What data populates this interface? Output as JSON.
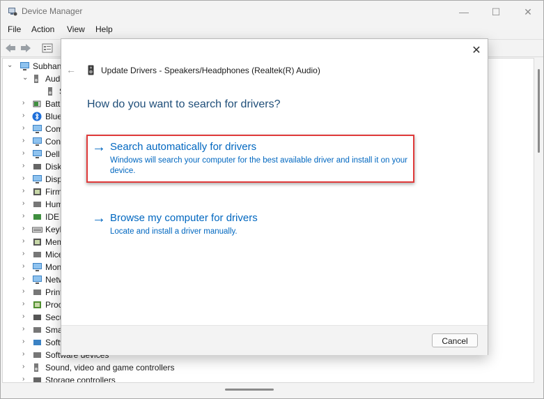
{
  "window": {
    "title": "Device Manager",
    "controls": {
      "minimize": "—",
      "maximize": "☐",
      "close": "✕"
    }
  },
  "menu": [
    "File",
    "Action",
    "View",
    "Help"
  ],
  "tree": {
    "root": "Subhan",
    "items": [
      {
        "label": "Audi",
        "icon": "speaker-icon",
        "expanded": true
      },
      {
        "label": "S",
        "icon": "speaker-icon",
        "child": true
      },
      {
        "label": "Batt",
        "icon": "battery-icon"
      },
      {
        "label": "Blue",
        "icon": "bluetooth-icon"
      },
      {
        "label": "Com",
        "icon": "computer-icon"
      },
      {
        "label": "Con",
        "icon": "monitor-icon"
      },
      {
        "label": "Dell",
        "icon": "monitor-icon"
      },
      {
        "label": "Disk",
        "icon": "disk-drive-icon"
      },
      {
        "label": "Disp",
        "icon": "display-adapter-icon"
      },
      {
        "label": "Firm",
        "icon": "firmware-icon"
      },
      {
        "label": "Hum",
        "icon": "hid-icon"
      },
      {
        "label": "IDE A",
        "icon": "ide-controller-icon"
      },
      {
        "label": "Keyb",
        "icon": "keyboard-icon"
      },
      {
        "label": "Mem",
        "icon": "memory-icon"
      },
      {
        "label": "Mice",
        "icon": "mouse-icon"
      },
      {
        "label": "Mon",
        "icon": "monitor-icon"
      },
      {
        "label": "Netw",
        "icon": "network-icon"
      },
      {
        "label": "Print",
        "icon": "printer-icon"
      },
      {
        "label": "Proc",
        "icon": "processor-icon"
      },
      {
        "label": "Secu",
        "icon": "security-device-icon"
      },
      {
        "label": "Sma",
        "icon": "smart-card-icon"
      },
      {
        "label": "Softw",
        "icon": "software-icon"
      },
      {
        "label": "Software devices",
        "icon": "software-device-icon"
      },
      {
        "label": "Sound, video and game controllers",
        "icon": "speaker-icon"
      },
      {
        "label": "Storage controllers",
        "icon": "storage-icon"
      }
    ]
  },
  "dialog": {
    "title": "Update Drivers - Speakers/Headphones (Realtek(R) Audio)",
    "question": "How do you want to search for drivers?",
    "options": [
      {
        "title": "Search automatically for drivers",
        "description": "Windows will search your computer for the best available driver and install it on your device."
      },
      {
        "title": "Browse my computer for drivers",
        "description": "Locate and install a driver manually."
      }
    ],
    "cancel_label": "Cancel"
  },
  "colors": {
    "link": "#0067c0",
    "highlight": "#e03a3a",
    "question": "#1f4e79"
  }
}
